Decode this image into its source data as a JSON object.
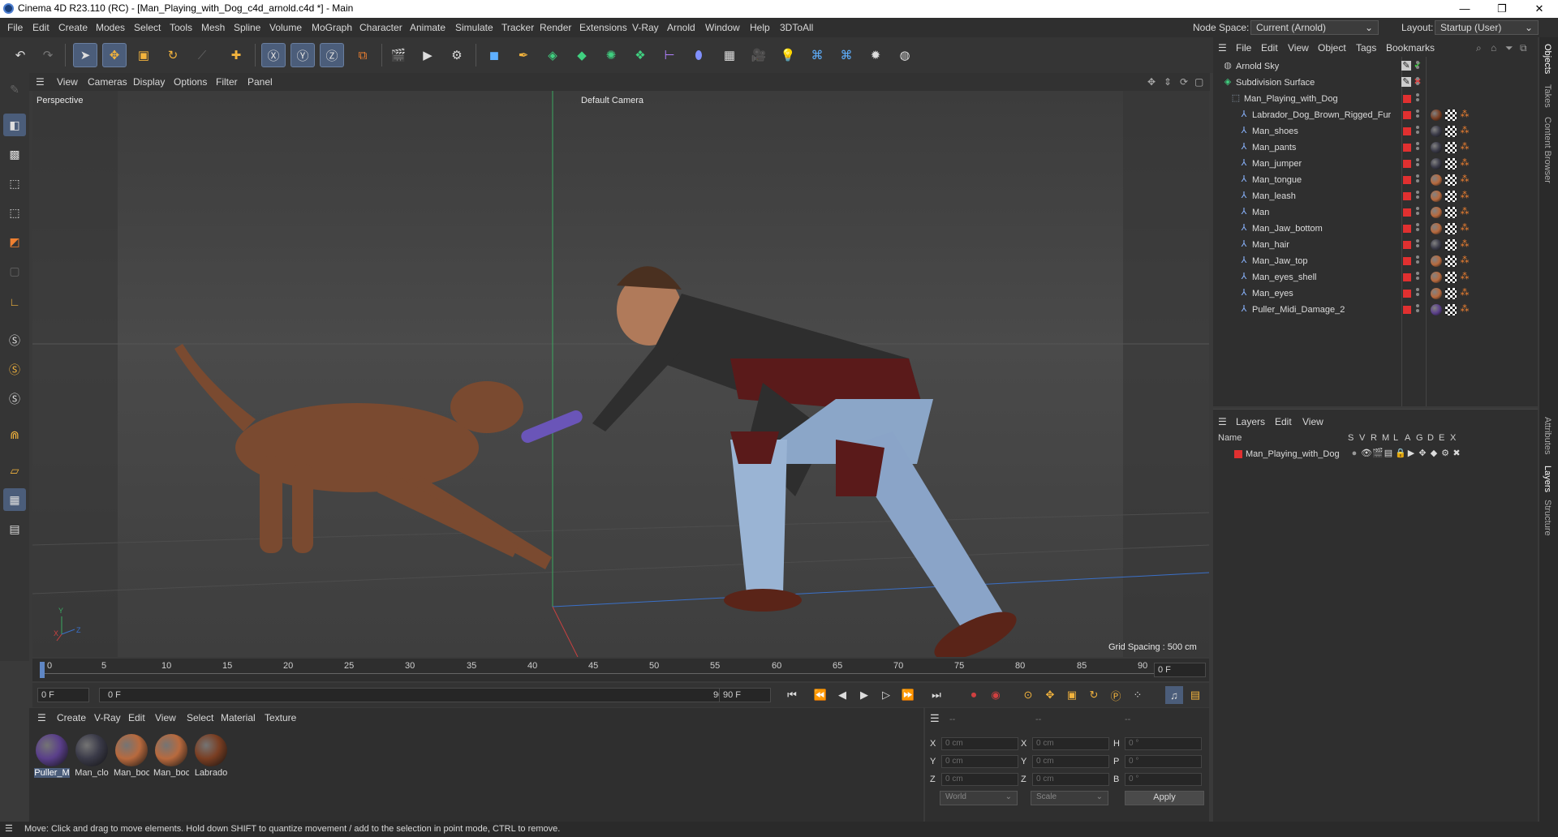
{
  "window": {
    "title": "Cinema 4D R23.110 (RC) - [Man_Playing_with_Dog_c4d_arnold.c4d *] - Main",
    "controls": [
      "—",
      "❐",
      "✕"
    ]
  },
  "menubar": {
    "items": [
      "File",
      "Edit",
      "Create",
      "Modes",
      "Select",
      "Tools",
      "Mesh",
      "Spline",
      "Volume",
      "MoGraph",
      "Character",
      "Animate",
      "Simulate",
      "Tracker",
      "Render",
      "Extensions",
      "V-Ray",
      "Arnold",
      "Window",
      "Help",
      "3DToAll"
    ],
    "node_space_label": "Node Space:",
    "node_space_value": "Current (Arnold)",
    "layout_label": "Layout:",
    "layout_value": "Startup (User)"
  },
  "viewport": {
    "menu": [
      "View",
      "Cameras",
      "Display",
      "Options",
      "Filter",
      "Panel"
    ],
    "label": "Perspective",
    "camera": "Default Camera",
    "grid_spacing": "Grid Spacing : 500 cm",
    "axis_y": "Y",
    "axis_x": "X",
    "axis_z": "Z"
  },
  "timeline": {
    "ticks": [
      "0",
      "5",
      "10",
      "15",
      "20",
      "25",
      "30",
      "35",
      "40",
      "45",
      "50",
      "55",
      "60",
      "65",
      "70",
      "75",
      "80",
      "85",
      "90"
    ],
    "current_frame": "0 F",
    "start_field": "0 F",
    "range_start": "0 F",
    "range_end": "90 F",
    "end_field": "90 F"
  },
  "material_manager": {
    "menu": [
      "Create",
      "V-Ray",
      "Edit",
      "View",
      "Select",
      "Material",
      "Texture"
    ],
    "materials": [
      {
        "label": "Puller_M",
        "color": "#5a3f8a"
      },
      {
        "label": "Man_clo",
        "color": "#3a3a48"
      },
      {
        "label": "Man_boc",
        "color": "#b86a3e"
      },
      {
        "label": "Man_boc",
        "color": "#b86a3e"
      },
      {
        "label": "Labrado",
        "color": "#7a3e22"
      }
    ]
  },
  "coordinates": {
    "header_dashes": [
      "--",
      "--",
      "--"
    ],
    "rows": [
      {
        "a": "X",
        "av": "0 cm",
        "b": "X",
        "bv": "0 cm",
        "c": "H",
        "cv": "0 °"
      },
      {
        "a": "Y",
        "av": "0 cm",
        "b": "Y",
        "bv": "0 cm",
        "c": "P",
        "cv": "0 °"
      },
      {
        "a": "Z",
        "av": "0 cm",
        "b": "Z",
        "bv": "0 cm",
        "c": "B",
        "cv": "0 °"
      }
    ],
    "mode1": "World",
    "mode2": "Scale",
    "apply": "Apply"
  },
  "object_manager": {
    "menu": [
      "File",
      "Edit",
      "View",
      "Object",
      "Tags",
      "Bookmarks"
    ],
    "objects": [
      {
        "name": "Arnold Sky",
        "indent": 0
      },
      {
        "name": "Subdivision Surface",
        "indent": 0
      },
      {
        "name": "Man_Playing_with_Dog",
        "indent": 1
      },
      {
        "name": "Labrador_Dog_Brown_Rigged_Fur",
        "indent": 2,
        "mat": "#7a3e22"
      },
      {
        "name": "Man_shoes",
        "indent": 2,
        "mat": "#3a3a48"
      },
      {
        "name": "Man_pants",
        "indent": 2,
        "mat": "#3a3a48"
      },
      {
        "name": "Man_jumper",
        "indent": 2,
        "mat": "#3a3a48"
      },
      {
        "name": "Man_tongue",
        "indent": 2,
        "mat": "#b86a3e"
      },
      {
        "name": "Man_leash",
        "indent": 2,
        "mat": "#b86a3e"
      },
      {
        "name": "Man",
        "indent": 2,
        "mat": "#b86a3e"
      },
      {
        "name": "Man_Jaw_bottom",
        "indent": 2,
        "mat": "#b86a3e"
      },
      {
        "name": "Man_hair",
        "indent": 2,
        "mat": "#3a3a48"
      },
      {
        "name": "Man_Jaw_top",
        "indent": 2,
        "mat": "#b86a3e"
      },
      {
        "name": "Man_eyes_shell",
        "indent": 2,
        "mat": "#b86a3e"
      },
      {
        "name": "Man_eyes",
        "indent": 2,
        "mat": "#b86a3e"
      },
      {
        "name": "Puller_Midi_Damage_2",
        "indent": 2,
        "mat": "#5a3f8a"
      }
    ]
  },
  "layers": {
    "menu": [
      "Layers",
      "Edit",
      "View"
    ],
    "columns": [
      "Name",
      "S",
      "V",
      "R",
      "M",
      "L",
      "A",
      "G",
      "D",
      "E",
      "X"
    ],
    "rows": [
      {
        "name": "Man_Playing_with_Dog"
      }
    ]
  },
  "side_tabs": [
    "Objects",
    "Takes",
    "Content Browser",
    "Attributes",
    "Layers",
    "Structure"
  ],
  "status": "Move: Click and drag to move elements. Hold down SHIFT to quantize movement / add to the selection in point mode, CTRL to remove."
}
